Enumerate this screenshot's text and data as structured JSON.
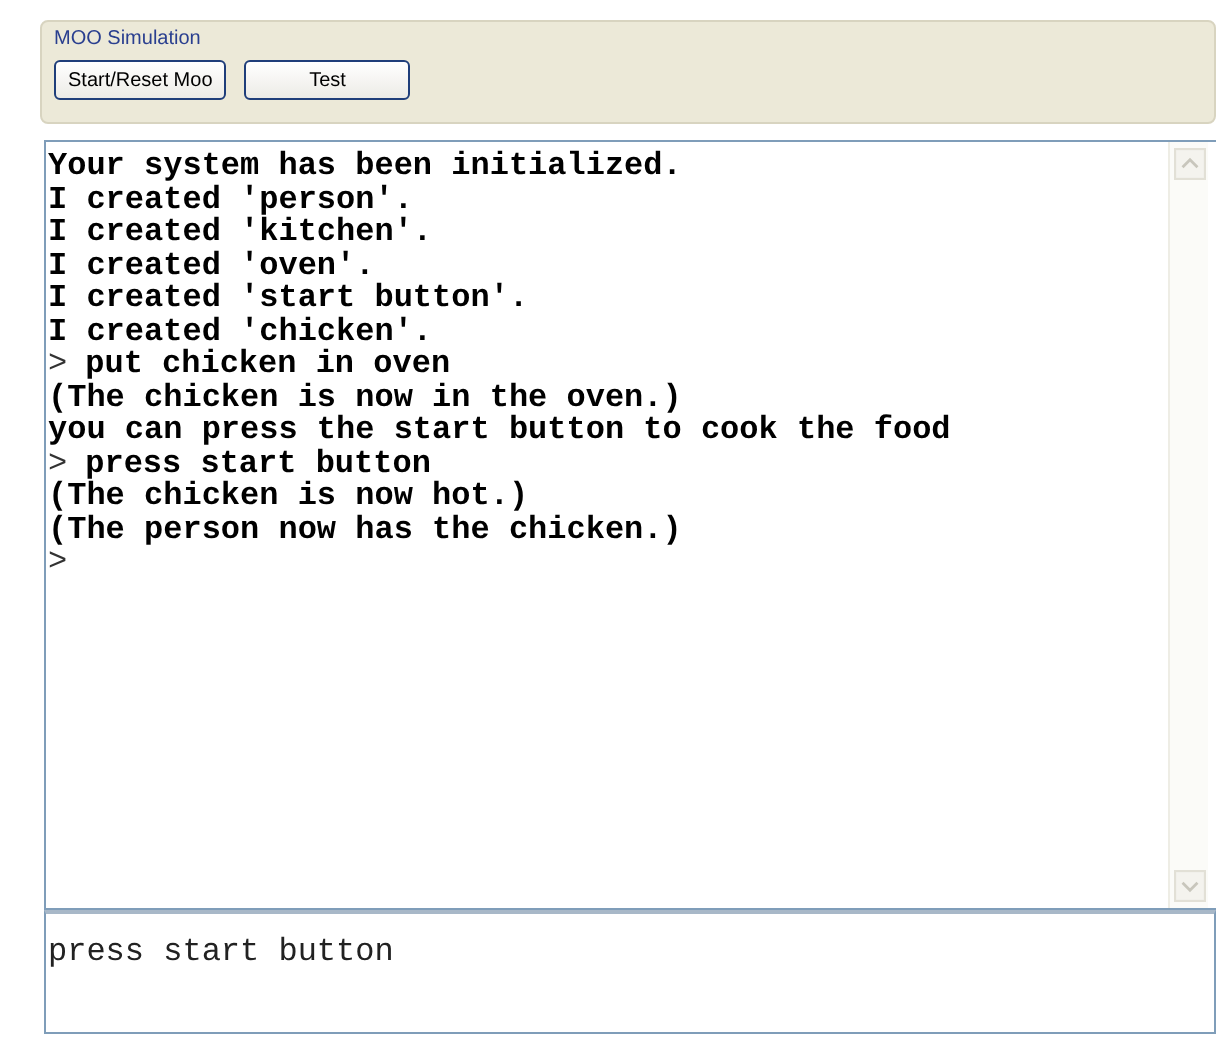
{
  "group_box": {
    "title": "MOO Simulation",
    "buttons": [
      {
        "label": "Start/Reset Moo"
      },
      {
        "label": "Test"
      }
    ]
  },
  "output": {
    "lines": [
      {
        "kind": "output",
        "text": "Your system has been initialized."
      },
      {
        "kind": "output",
        "text": "I created 'person'."
      },
      {
        "kind": "output",
        "text": "I created 'kitchen'."
      },
      {
        "kind": "output",
        "text": "I created 'oven'."
      },
      {
        "kind": "output",
        "text": "I created 'start button'."
      },
      {
        "kind": "output",
        "text": "I created 'chicken'."
      },
      {
        "kind": "command",
        "prompt": ">",
        "text": "put chicken in oven"
      },
      {
        "kind": "output",
        "text": "(The chicken is now in the oven.)"
      },
      {
        "kind": "output",
        "text": "you can press the start button to cook the food"
      },
      {
        "kind": "command",
        "prompt": ">",
        "text": "press start button"
      },
      {
        "kind": "output",
        "text": "(The chicken is now hot.)"
      },
      {
        "kind": "output",
        "text": "(The person now has the chicken.)"
      },
      {
        "kind": "command",
        "prompt": ">"
      }
    ]
  },
  "input": {
    "value": "press start button"
  }
}
